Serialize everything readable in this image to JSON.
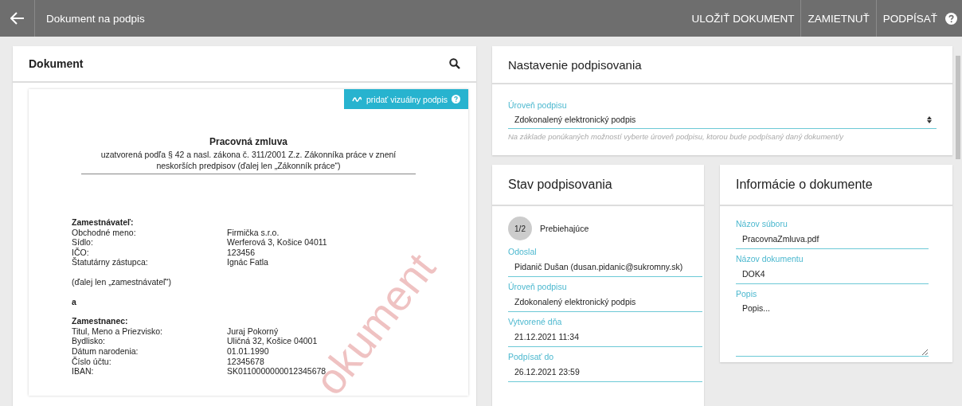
{
  "top_bar": {
    "title": "Dokument na podpis",
    "actions": [
      "ULOŽIŤ DOKUMENT",
      "ZAMIETNUŤ",
      "PODPÍSAŤ"
    ]
  },
  "document_panel": {
    "title": "Dokument",
    "add_signature_button": "pridať vizuálny podpis",
    "page": {
      "title": "Pracovná zmluva",
      "subtitle": "uzatvorená podľa § 42 a nasl. zákona č. 311/2001 Z.z. Zákonníka práce v znení neskorších predpisov (ďalej len „Zákonník práce“)",
      "watermark": "okument",
      "sections": [
        {
          "heading": "Zamestnávateľ:",
          "rows": [
            {
              "label": "Obchodné meno:",
              "value": "Firmička s.r.o."
            },
            {
              "label": "Sídlo:",
              "value": "Werferová 3, Košice 04011"
            },
            {
              "label": "IČO:",
              "value": "123456"
            },
            {
              "label": "Štatutárny zástupca:",
              "value": "Ignác Fatla"
            }
          ],
          "note": "(ďalej len „zamestnávateľ“)"
        },
        {
          "heading": "a"
        },
        {
          "heading": "Zamestnanec:",
          "rows": [
            {
              "label": "Titul, Meno a Priezvisko:",
              "value": "Juraj Pokorný"
            },
            {
              "label": "Bydlisko:",
              "value": "Uličná 32, Košice 04001"
            },
            {
              "label": "Dátum narodenia:",
              "value": "01.01.1990"
            },
            {
              "label": "Číslo účtu:",
              "value": "12345678"
            },
            {
              "label": "IBAN:",
              "value": "SK0110000000012345678"
            }
          ]
        }
      ]
    }
  },
  "settings_panel": {
    "title": "Nastavenie podpisovania",
    "field": {
      "label": "Úroveň podpisu",
      "value": "Zdokonalený elektronický podpis",
      "hint": "Na základe ponúkaných možností vyberte úroveň podpisu, ktorou bude podpísaný daný dokument/y"
    }
  },
  "status_panel": {
    "title": "Stav podpisovania",
    "progress": "1/2",
    "state": "Prebiehajúce",
    "fields": [
      {
        "label": "Odoslal",
        "value": "Pidanič Dušan (dusan.pidanic@sukromny.sk)"
      },
      {
        "label": "Úroveň podpisu",
        "value": "Zdokonalený elektronický podpis"
      },
      {
        "label": "Vytvorené dňa",
        "value": "21.12.2021 11:34"
      },
      {
        "label": "Podpísať do",
        "value": "26.12.2021 23:59"
      }
    ]
  },
  "info_panel": {
    "title": "Informácie o dokumente",
    "fields": [
      {
        "kind": "input",
        "label": "Názov súboru",
        "value": "PracovnaZmluva.pdf"
      },
      {
        "kind": "input",
        "label": "Názov dokumentu",
        "value": "DOK4"
      },
      {
        "kind": "textarea",
        "label": "Popis",
        "value": "Popis..."
      }
    ]
  }
}
